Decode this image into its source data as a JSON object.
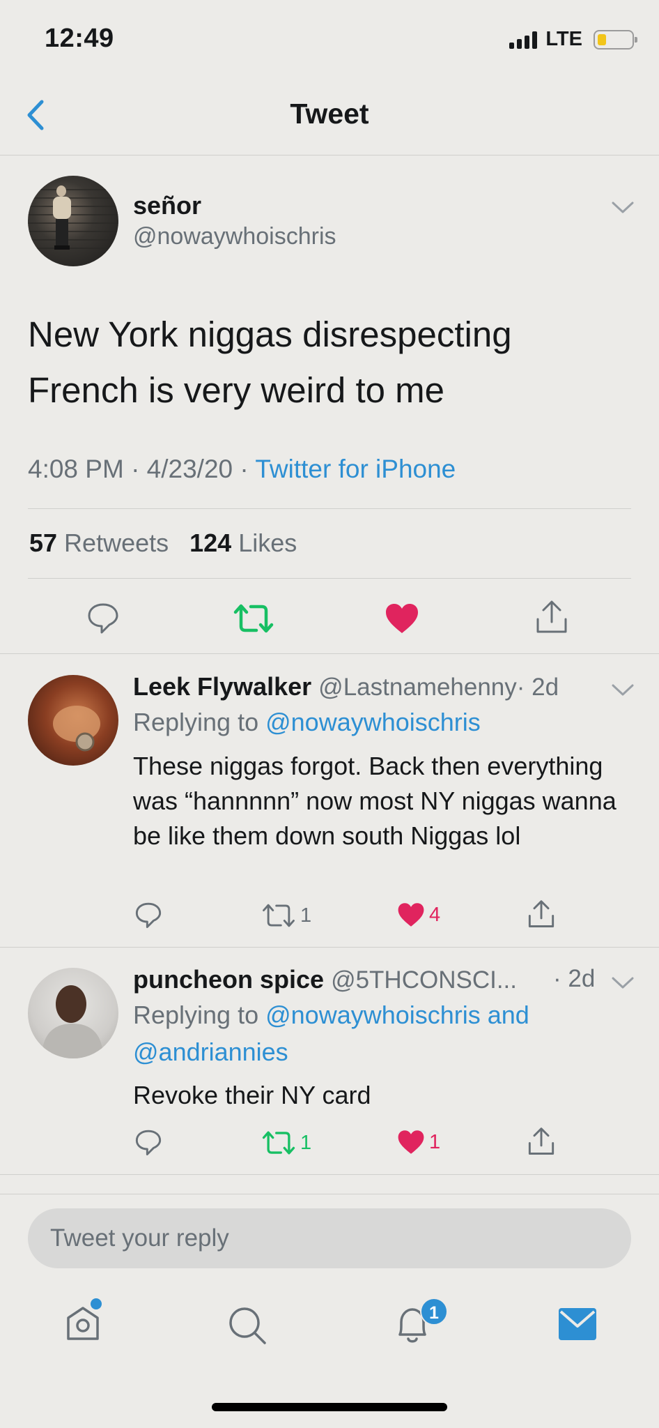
{
  "status_bar": {
    "time": "12:49",
    "network": "LTE",
    "battery_level": 0.15
  },
  "nav": {
    "title": "Tweet",
    "back_icon": "chevron-left-icon"
  },
  "tweet": {
    "name": "señor",
    "handle": "@nowaywhoischris",
    "text": "New York niggas disrespecting French is very weird to me",
    "time": "4:08 PM · 4/23/20 · ",
    "source": "Twitter for iPhone",
    "retweets_count": "57",
    "retweets_label": " Retweets",
    "likes_count": "124",
    "likes_label": " Likes",
    "liked": true,
    "retweeted": true
  },
  "replies": [
    {
      "name": "Leek Flywalker",
      "handle": "@Lastnamehenny",
      "age": "· 2d",
      "replying_prefix": "Replying to ",
      "replying_to": "@nowaywhoischris",
      "replying_to_2": "",
      "text": "These niggas forgot. Back then everything was “hannnnn” now most NY niggas wanna be like them down south Niggas lol",
      "retweets": "1",
      "likes": "4"
    },
    {
      "name": "puncheon spice",
      "handle": "@5THCONSCI...",
      "age": "· 2d",
      "replying_prefix": "Replying to ",
      "replying_to": "@nowaywhoischris and",
      "replying_to_2": "@andriannies",
      "text": "Revoke their NY card",
      "retweets": "1",
      "likes": "1"
    }
  ],
  "compose": {
    "placeholder": "Tweet your reply"
  },
  "tab_bar": {
    "items": [
      "home-icon",
      "search-icon",
      "notifications-icon",
      "messages-icon"
    ],
    "notification_badge": "1"
  },
  "colors": {
    "accent": "#2d8fd3",
    "like": "#e0245e",
    "retweet": "#17bf63",
    "background": "#ecebe8"
  }
}
